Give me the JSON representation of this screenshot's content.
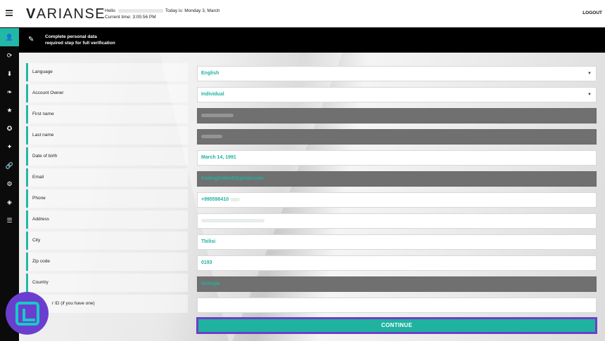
{
  "header": {
    "logo_text": "ARIANSE",
    "logo_initial": "V",
    "hello_label": "Hello",
    "today_label": "Today is: Monday 3, March",
    "current_time": "Current time: 3:05:56 PM",
    "logout_label": "LOGOUT"
  },
  "sidebar": {
    "items": [
      {
        "icon": "user-icon",
        "glyph": "👤",
        "active": true
      },
      {
        "icon": "refresh-icon",
        "glyph": "⟳"
      },
      {
        "icon": "download-icon",
        "glyph": "⬇"
      },
      {
        "icon": "leaf-icon",
        "glyph": "❧"
      },
      {
        "icon": "star-icon",
        "glyph": "★"
      },
      {
        "icon": "settings-ring-icon",
        "glyph": "✪"
      },
      {
        "icon": "puzzle-icon",
        "glyph": "✦"
      },
      {
        "icon": "link-icon",
        "glyph": "🔗"
      },
      {
        "icon": "gear-icon",
        "glyph": "⚙"
      },
      {
        "icon": "layers-icon",
        "glyph": "◈"
      },
      {
        "icon": "database-icon",
        "glyph": "☰"
      }
    ]
  },
  "banner": {
    "line1": "Complete personal data",
    "line2": "required step for full verification",
    "icon": "pencil-icon"
  },
  "form": {
    "language": {
      "label": "Language",
      "value": "English"
    },
    "account_owner": {
      "label": "Account Owner",
      "value": "Individual"
    },
    "first_name": {
      "label": "First name",
      "value": ""
    },
    "last_name": {
      "label": "Last name",
      "value": ""
    },
    "dob": {
      "label": "Date of birth",
      "value": "March 14, 1991"
    },
    "email": {
      "label": "Email",
      "value": "tradingfinder6@gmail.com"
    },
    "phone": {
      "label": "Phone",
      "value": "+995598410"
    },
    "address": {
      "label": "Address",
      "value": ""
    },
    "city": {
      "label": "City",
      "value": "Tbilisi"
    },
    "zip": {
      "label": "Zip code",
      "value": "0193"
    },
    "country": {
      "label": "Country",
      "value": "Georgia"
    },
    "tax_id": {
      "label": "r ID (if you have one)",
      "value": ""
    }
  },
  "continue_label": "CONTINUE",
  "colors": {
    "accent": "#21b8a6",
    "badge": "#6a3fcf",
    "grey_field": "#707070"
  }
}
